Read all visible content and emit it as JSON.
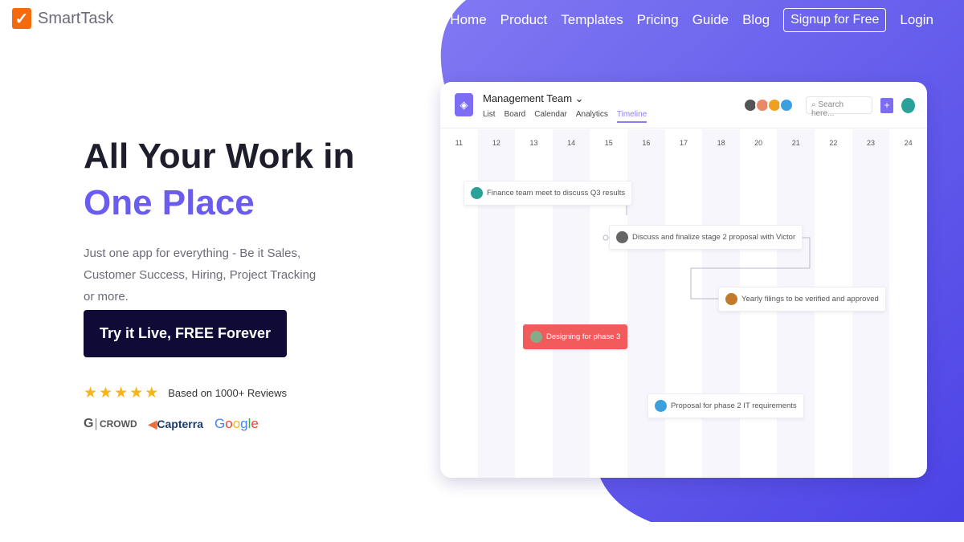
{
  "brand": {
    "name": "SmartTask",
    "logo_color": "#f46b0f"
  },
  "nav": {
    "items": [
      "Home",
      "Product",
      "Templates",
      "Pricing",
      "Guide",
      "Blog"
    ],
    "signup": "Signup for Free",
    "login": "Login"
  },
  "hero": {
    "title_line1": "All Your Work in",
    "title_line2": "One Place",
    "subtitle": "Just one app for everything - Be it Sales, Customer Success, Hiring, Project Tracking or more.",
    "cta": "Try it Live, FREE Forever",
    "rating_stars": 5,
    "reviews": "Based on 1000+ Reviews",
    "badges": [
      "CROWD",
      "Capterra",
      "Google"
    ]
  },
  "colors": {
    "accent": "#6b5cf0",
    "cta_bg": "#0f0b36",
    "red_task": "#f25b5b",
    "star": "#f8b418"
  },
  "app": {
    "team": "Management Team",
    "tabs": [
      "List",
      "Board",
      "Calendar",
      "Analytics",
      "Timeline"
    ],
    "active_tab": "Timeline",
    "search_placeholder": "Search here...",
    "plus": "+",
    "days": [
      "11",
      "12",
      "13",
      "14",
      "15",
      "16",
      "17",
      "18",
      "20",
      "21",
      "22",
      "23",
      "24"
    ],
    "tasks": [
      "Finance team meet to discuss Q3 results",
      "Discuss and finalize stage 2 proposal with Victor",
      "Yearly filings to be verified and approved",
      "Designing for phase 3",
      "Proposal for phase 2 IT requirements"
    ]
  }
}
